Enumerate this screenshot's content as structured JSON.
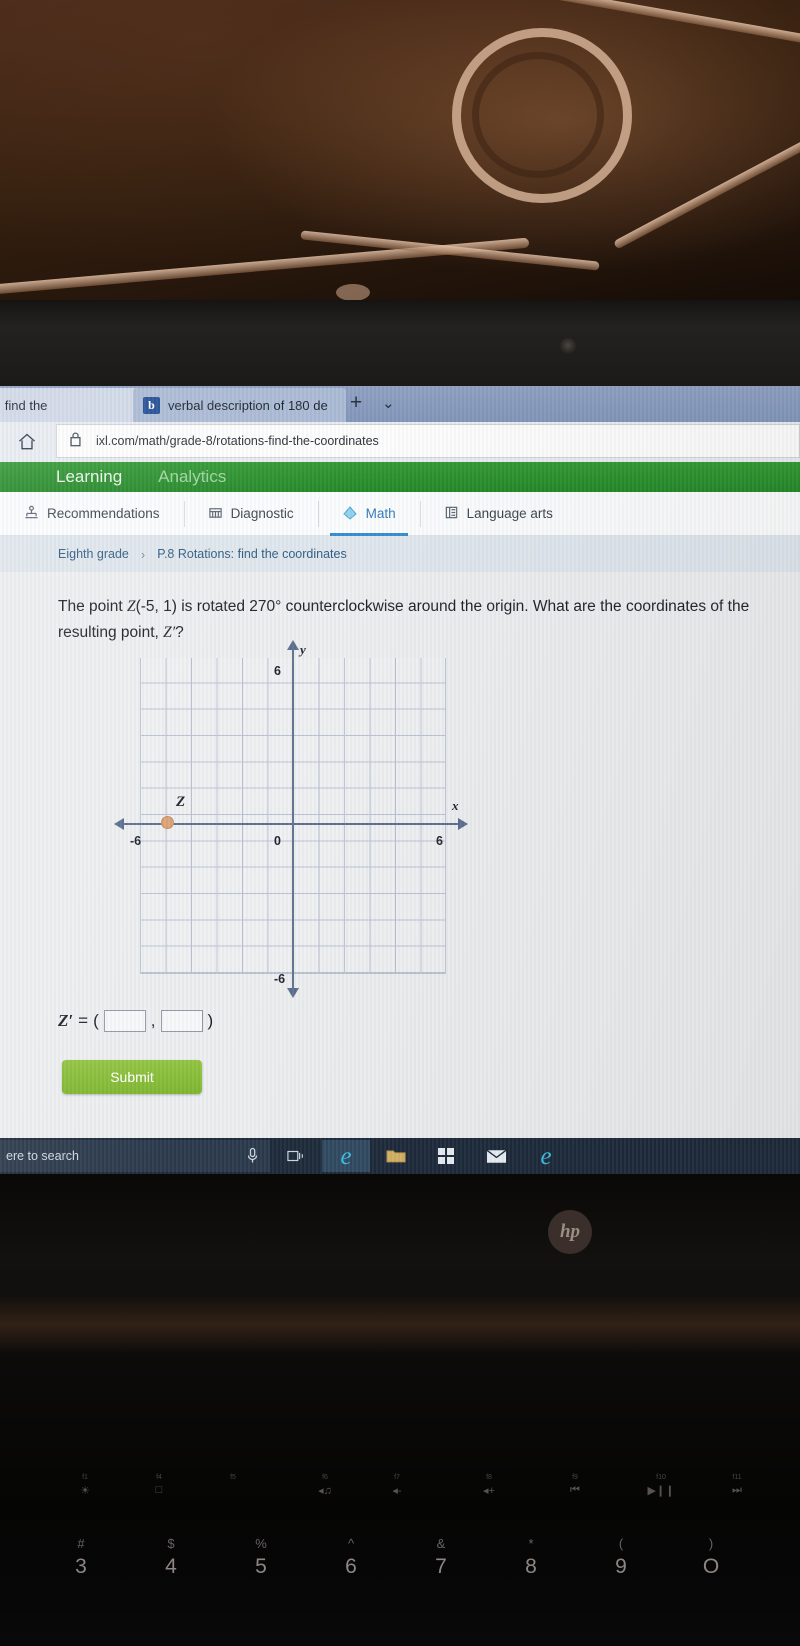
{
  "browser": {
    "tabs": [
      {
        "title": "otations: find the",
        "close_label": "✕",
        "icon": "page-icon",
        "active": true
      },
      {
        "title": "verbal description of 180 de",
        "icon": "bing-icon",
        "icon_glyph": "b",
        "active": false
      }
    ],
    "new_tab_label": "+",
    "tab_list_chevron": "⌄",
    "home_icon": "home-icon",
    "lock_icon": "lock-icon",
    "url": "ixl.com/math/grade-8/rotations-find-the-coordinates"
  },
  "ixl": {
    "navbar": {
      "learning": "Learning",
      "analytics": "Analytics"
    },
    "subjects": [
      {
        "label": "Recommendations",
        "icon": "recommendations-icon",
        "glyph": "⚙",
        "active": false
      },
      {
        "label": "Diagnostic",
        "icon": "diagnostic-icon",
        "glyph": "☷",
        "active": false
      },
      {
        "label": "Math",
        "icon": "math-diamond-icon",
        "glyph": "◆",
        "active": true
      },
      {
        "label": "Language arts",
        "icon": "book-icon",
        "glyph": "☷",
        "active": false
      }
    ],
    "breadcrumb": {
      "grade": "Eighth grade",
      "separator": "›",
      "skill": "P.8 Rotations: find the coordinates"
    },
    "question": {
      "line1_a": "The point ",
      "point_name": "Z",
      "line1_b": "(-5, 1) is rotated 270° counterclockwise around the origin. What are the",
      "line2_a": "coordinates of the resulting point, ",
      "point_prime": "Z′",
      "line2_b": "?"
    },
    "answer": {
      "prefix": "Z′",
      "equals": "=",
      "open_paren": "(",
      "comma": ",",
      "close_paren": ")",
      "x_value": "",
      "y_value": ""
    },
    "submit_label": "Submit"
  },
  "chart_data": {
    "type": "scatter",
    "title": "",
    "xlabel": "x",
    "ylabel": "y",
    "xlim": [
      -6,
      6
    ],
    "ylim": [
      -6,
      6
    ],
    "grid": true,
    "x_ticks": [
      "-6",
      "0",
      "6"
    ],
    "y_ticks": [
      "6",
      "-6"
    ],
    "y_top_label": "6",
    "y_bottom_label": "-6",
    "x_left_label": "-6",
    "x_origin_label": "0",
    "x_right_label": "6",
    "points": [
      {
        "label": "Z",
        "x": -5,
        "y": 1,
        "color": "#e0a072"
      }
    ],
    "legend": "none"
  },
  "taskbar": {
    "search_placeholder": "ere to search",
    "mic_icon": "microphone-icon",
    "taskview_icon": "task-view-icon",
    "items": [
      {
        "icon": "edge-icon",
        "glyph": "e",
        "active": true
      },
      {
        "icon": "file-explorer-icon",
        "glyph": "▤",
        "active": false
      },
      {
        "icon": "store-icon",
        "glyph": "▦",
        "active": false
      },
      {
        "icon": "mail-icon",
        "glyph": "✉",
        "active": false
      },
      {
        "icon": "edge-icon-2",
        "glyph": "e",
        "active": false
      }
    ]
  },
  "laptop": {
    "brand": "hp",
    "fn_keys": [
      {
        "fn": "f1",
        "glyph": "☀"
      },
      {
        "fn": "f4",
        "glyph": "□"
      },
      {
        "fn": "f5",
        "glyph": ""
      },
      {
        "fn": "f6",
        "glyph": "◂♫"
      },
      {
        "fn": "f7",
        "glyph": "◂-"
      },
      {
        "fn": "f8",
        "glyph": "◂+"
      },
      {
        "fn": "f9",
        "glyph": "⏮"
      },
      {
        "fn": "f10",
        "glyph": "▶❙❙"
      },
      {
        "fn": "f11",
        "glyph": "⏭"
      }
    ],
    "number_keys": [
      {
        "symbol": "#",
        "digit": "3"
      },
      {
        "symbol": "$",
        "digit": "4"
      },
      {
        "symbol": "%",
        "digit": "5"
      },
      {
        "symbol": "^",
        "digit": "6"
      },
      {
        "symbol": "&",
        "digit": "7"
      },
      {
        "symbol": "*",
        "digit": "8"
      },
      {
        "symbol": "(",
        "digit": "9"
      },
      {
        "symbol": ")",
        "digit": "O"
      }
    ]
  }
}
